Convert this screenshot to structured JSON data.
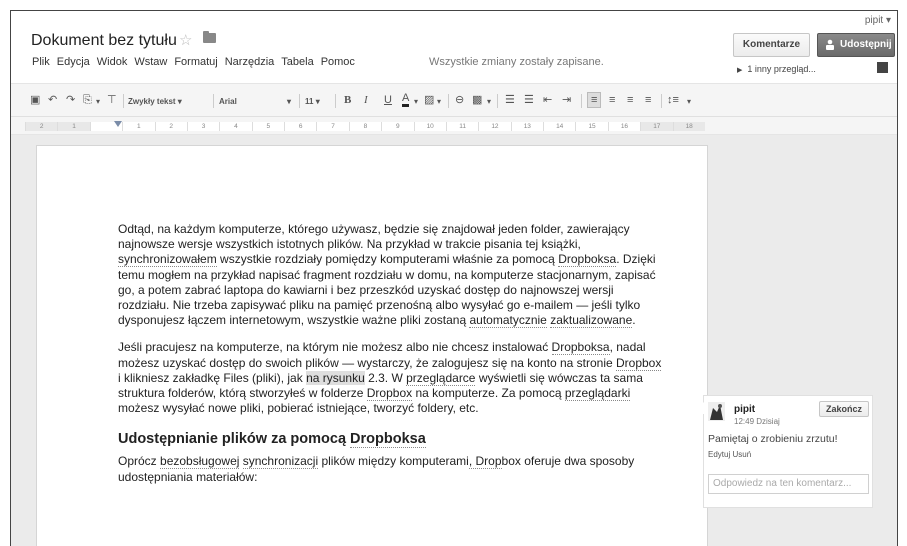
{
  "header": {
    "user": "pipit ▾",
    "title": "Dokument bez tytułu",
    "menu": [
      "Plik",
      "Edycja",
      "Widok",
      "Wstaw",
      "Formatuj",
      "Narzędzia",
      "Tabela",
      "Pomoc"
    ],
    "save_status": "Wszystkie zmiany zostały zapisane.",
    "comments_button": "Komentarze",
    "share_button": "Udostępnij",
    "revisions": "1 inny przegląd..."
  },
  "toolbar": {
    "style": "Zwykły tekst",
    "font": "Arial",
    "size": "11",
    "bold": "B",
    "italic": "I",
    "underline": "U",
    "text_color": "A",
    "highlight": "A"
  },
  "ruler": {
    "ticks": [
      "2",
      "1",
      "",
      "1",
      "2",
      "3",
      "4",
      "5",
      "6",
      "7",
      "8",
      "9",
      "10",
      "11",
      "12",
      "13",
      "14",
      "15",
      "16",
      "17",
      "18"
    ]
  },
  "document": {
    "p1": {
      "a": "Odtąd, na każdym komputerze, którego używasz, będzie się znajdował jeden folder, zawierający najnowsze wersje wszystkich istotnych plików. Na przykład w trakcie pisania tej książki, ",
      "b": "synchronizowałem",
      "c": " wszystkie rozdziały pomiędzy komputerami właśnie za pomocą ",
      "d": "Dropboksa",
      "e": ". Dzięki temu mogłem na przykład napisać fragment rozdziału w domu, na komputerze stacjonarnym, zapisać go, a potem zabrać laptopa do kawiarni i bez przeszkód uzyskać dostęp do najnowszej wersji rozdziału. Nie trzeba zapisywać pliku na pamięć przenośną albo wysyłać go e-mailem — jeśli tylko dysponujesz łączem internetowym, wszystkie ważne pliki zostaną ",
      "f": "automatycznie",
      "g": " ",
      "h": "zaktualizowane",
      "i": "."
    },
    "p2": {
      "a": "Jeśli pracujesz na komputerze, na którym nie możesz albo nie chcesz instalować ",
      "b": "Dropboksa",
      "c": ", nadal możesz uzyskać dostęp do swoich plików — wystarczy, że zalogujesz się na konto na stronie ",
      "d": "Dropbox",
      "e": " i klikniesz zakładkę Files (pliki), jak ",
      "f": "na rysunku",
      "g": " 2.3. W ",
      "h": "przeglądarce",
      "i": " wyświetli się wówczas ta sama struktura folderów, którą stworzyłeś w folderze ",
      "j": "Dropbox",
      "k": " na komputerze. Za pomocą ",
      "l": "przeglądarki",
      "m": " możesz wysyłać nowe pliki, pobierać istniejące, tworzyć foldery, etc."
    },
    "h2": {
      "a": "Udostępnianie plików za pomocą ",
      "b": "Dropboksa"
    },
    "p3": {
      "a": "Oprócz ",
      "b": "bezobsługowej",
      "c": " ",
      "d": "synchronizacji",
      "e": " plików między komputerami",
      "f": ", Drop",
      "g": "box oferuje dwa sposoby udostępniania materiałów:"
    }
  },
  "comment": {
    "author": "pipit",
    "time": "12:49 Dzisiaj",
    "resolve": "Zakończ",
    "text": "Pamiętaj o zrobieniu zrzutu!",
    "edit": "Edytuj",
    "delete": "Usuń",
    "reply_placeholder": "Odpowiedz na ten komentarz..."
  }
}
